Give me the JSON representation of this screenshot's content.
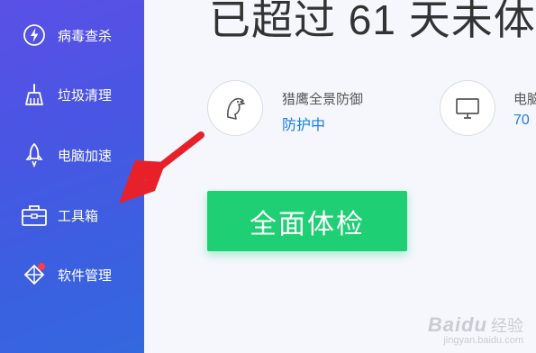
{
  "sidebar": {
    "items": [
      {
        "label": "病毒查杀",
        "icon": "lightning-shield-icon"
      },
      {
        "label": "垃圾清理",
        "icon": "broom-icon"
      },
      {
        "label": "电脑加速",
        "icon": "rocket-icon"
      },
      {
        "label": "工具箱",
        "icon": "toolbox-icon"
      },
      {
        "label": "软件管理",
        "icon": "software-manager-icon",
        "badge": true
      }
    ]
  },
  "main": {
    "headline": "已超过 61 天未体",
    "features": [
      {
        "title": "猎鹰全景防御",
        "status": "防护中",
        "icon": "eagle-icon"
      },
      {
        "title": "电脑",
        "status": "70",
        "icon": "monitor-icon"
      }
    ],
    "check_button": "全面体检"
  },
  "annotation": {
    "icon": "red-arrow-icon",
    "color": "#e8202a"
  },
  "watermark": {
    "brand": "Baidu",
    "cn": "经验",
    "url": "jingyan.baidu.com"
  },
  "colors": {
    "sidebar_gradient_start": "#5b50e6",
    "sidebar_gradient_end": "#3468df",
    "accent_green": "#1fcf74",
    "status_blue": "#1a7fe8",
    "badge_red": "#ff3b4a"
  }
}
